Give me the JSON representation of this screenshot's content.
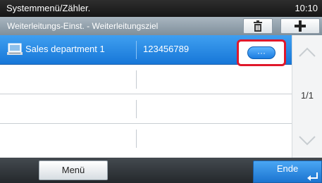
{
  "status": {
    "title": "Systemmenü/Zähler.",
    "time": "10:10"
  },
  "header": {
    "title": "Weiterleitungs-Einst. - Weiterleitungsziel",
    "delete_icon": "trash-icon",
    "add_icon": "plus-icon"
  },
  "list": {
    "rows": [
      {
        "name": "Sales department 1",
        "number": "123456789",
        "icon": "computer-icon",
        "selected": true
      },
      {
        "name": "",
        "number": ""
      },
      {
        "name": "",
        "number": ""
      },
      {
        "name": "",
        "number": ""
      }
    ],
    "detail_button_label": "···"
  },
  "pager": {
    "page": "1/1",
    "up_icon": "chevron-up-icon",
    "down_icon": "chevron-down-icon"
  },
  "footer": {
    "menu_label": "Menü",
    "end_label": "Ende",
    "enter_icon": "enter-icon"
  },
  "colors": {
    "accent": "#1b7ce0",
    "highlight": "#e0182b"
  }
}
